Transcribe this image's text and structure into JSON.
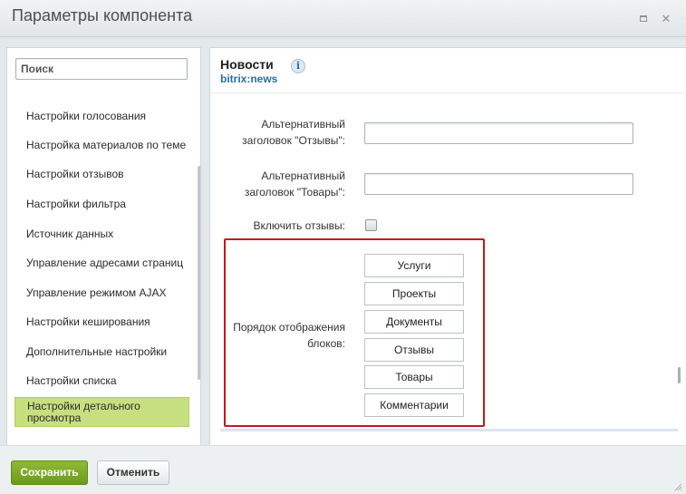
{
  "window": {
    "title": "Параметры компонента",
    "controls": [
      "maximize-icon",
      "close-icon"
    ],
    "close_glyph": "✕"
  },
  "sidebar": {
    "search_placeholder": "Поиск",
    "items": [
      {
        "label": "Настройки голосования"
      },
      {
        "label": "Настройка материалов по теме"
      },
      {
        "label": "Настройки отзывов"
      },
      {
        "label": "Настройки фильтра"
      },
      {
        "label": "Источник данных"
      },
      {
        "label": "Управление адресами страниц"
      },
      {
        "label": "Управление режимом AJAX"
      },
      {
        "label": "Настройки кеширования"
      },
      {
        "label": "Дополнительные настройки"
      },
      {
        "label": "Настройки списка"
      },
      {
        "label": "Настройки детального просмотра",
        "active": true
      }
    ],
    "active_color": "#c8df80"
  },
  "main": {
    "component_name": "Новости",
    "component_code": "bitrix:news",
    "info_icon": "i",
    "fields": {
      "alt_reviews_label": "Альтернативный заголовок \"Отзывы\":",
      "alt_reviews_value": "",
      "alt_products_label": "Альтернативный заголовок \"Товары\":",
      "alt_products_value": "",
      "enable_reviews_label": "Включить отзывы:",
      "enable_reviews_checked": false
    },
    "block_order": {
      "label": "Порядок отображения блоков:",
      "items": [
        "Услуги",
        "Проекты",
        "Документы",
        "Отзывы",
        "Товары",
        "Комментарии"
      ],
      "highlight_color": "#c8171c"
    }
  },
  "footer": {
    "save_label": "Сохранить",
    "cancel_label": "Отменить",
    "save_color": "#7aa829"
  }
}
